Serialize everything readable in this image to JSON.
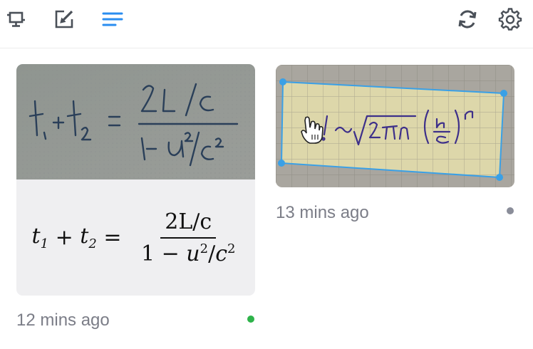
{
  "toolbar": {
    "left_icons": [
      "screen-capture-icon",
      "edit-icon",
      "list-icon"
    ],
    "right_icons": [
      "sync-icon",
      "gear-icon"
    ],
    "accent": "#2a8df0"
  },
  "items": [
    {
      "photo_text": "t, + t₂ = 2L / c over 1 - u²/c²",
      "rendered": {
        "lhs_a": "t",
        "sub_a": "1",
        "plus": " + ",
        "lhs_b": "t",
        "sub_b": "2",
        "eq": " = ",
        "num": "2L/c",
        "den_a": "1 − ",
        "den_u": "u",
        "den_exp1": "2",
        "den_slash": "/",
        "den_c": "c",
        "den_exp2": "2"
      },
      "time": "12 mins ago",
      "status_color": "#2eb34a"
    },
    {
      "photo_text": "!~ √2πn (n/e)ⁿ",
      "time": "13 mins ago",
      "status_color": "#8a8d99"
    }
  ]
}
